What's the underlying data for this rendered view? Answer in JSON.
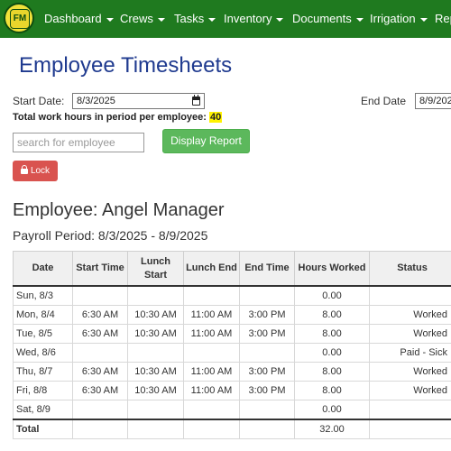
{
  "nav": {
    "logo_text": "FM",
    "items": [
      "Dashboard",
      "Crews",
      "Tasks",
      "Inventory",
      "Documents",
      "Irrigation",
      "Rep"
    ]
  },
  "page": {
    "title": "Employee Timesheets",
    "start_label": "Start Date:",
    "start_value": "8/3/2025",
    "end_label": "End Date",
    "end_value": "8/9/202",
    "total_hours_label": "Total work hours in period per employee:",
    "total_hours_value": "40",
    "search_placeholder": "search for employee",
    "display_button": "Display Report",
    "lock_button": "Lock"
  },
  "employee": {
    "title": "Employee: Angel Manager",
    "payroll_period": "Payroll Period: 8/3/2025 - 8/9/2025"
  },
  "table": {
    "headers": [
      "Date",
      "Start Time",
      "Lunch Start",
      "Lunch End",
      "End Time",
      "Hours Worked",
      "Status"
    ],
    "rows": [
      [
        "Sun, 8/3",
        "",
        "",
        "",
        "",
        "0.00",
        ""
      ],
      [
        "Mon, 8/4",
        "6:30 AM",
        "10:30 AM",
        "11:00 AM",
        "3:00 PM",
        "8.00",
        "Worked"
      ],
      [
        "Tue, 8/5",
        "6:30 AM",
        "10:30 AM",
        "11:00 AM",
        "3:00 PM",
        "8.00",
        "Worked"
      ],
      [
        "Wed, 8/6",
        "",
        "",
        "",
        "",
        "0.00",
        "Paid - Sick"
      ],
      [
        "Thu, 8/7",
        "6:30 AM",
        "10:30 AM",
        "11:00 AM",
        "3:00 PM",
        "8.00",
        "Worked"
      ],
      [
        "Fri, 8/8",
        "6:30 AM",
        "10:30 AM",
        "11:00 AM",
        "3:00 PM",
        "8.00",
        "Worked"
      ],
      [
        "Sat, 8/9",
        "",
        "",
        "",
        "",
        "0.00",
        ""
      ]
    ],
    "total": [
      "Total",
      "",
      "",
      "",
      "",
      "32.00",
      ""
    ]
  }
}
